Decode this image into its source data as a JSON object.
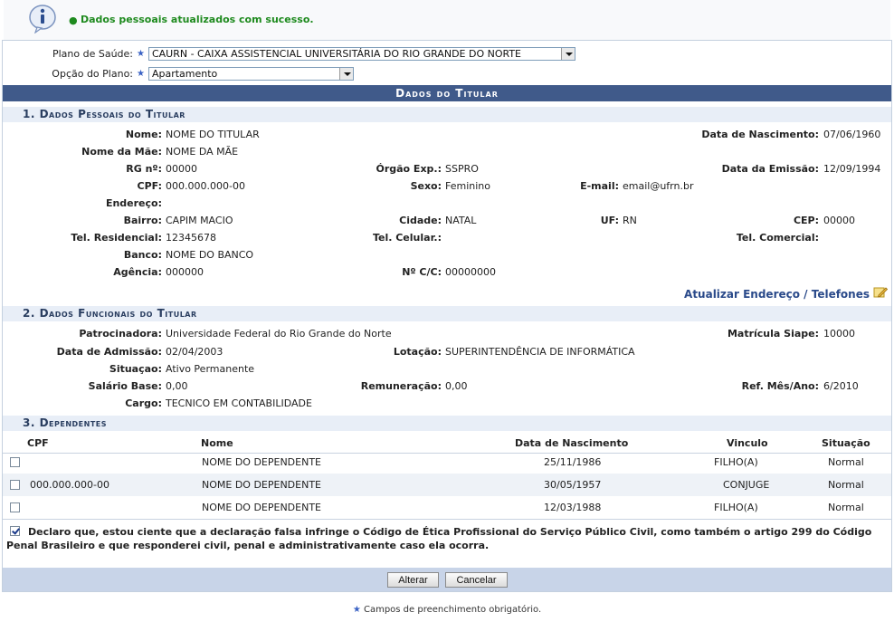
{
  "message": {
    "text": "Dados pessoais atualizados com sucesso."
  },
  "plan": {
    "health_label": "Plano de Saúde:",
    "health_value": "CAURN - CAIXA ASSISTENCIAL UNIVERSITÁRIA DO RIO GRANDE DO NORTE",
    "option_label": "Opção do Plano:",
    "option_value": "Apartamento"
  },
  "title": "Dados do Titular",
  "personal": {
    "heading": "1. Dados Pessoais do Titular",
    "nome_label": "Nome:",
    "nome": "NOME DO TITULAR",
    "nasc_label": "Data de Nascimento:",
    "nasc": "07/06/1960",
    "mae_label": "Nome da Mãe:",
    "mae": "NOME DA MÃE",
    "rg_label": "RG nº:",
    "rg": "00000",
    "orgao_label": "Órgão Exp.:",
    "orgao": "SSPRO",
    "emissao_label": "Data da Emissão:",
    "emissao": "12/09/1994",
    "cpf_label": "CPF:",
    "cpf": "000.000.000-00",
    "sexo_label": "Sexo:",
    "sexo": "Feminino",
    "email_label": "E-mail:",
    "email": "email@ufrn.br",
    "endereco_label": "Endereço:",
    "endereco": "",
    "bairro_label": "Bairro:",
    "bairro": "CAPIM MACIO",
    "cidade_label": "Cidade:",
    "cidade": "NATAL",
    "uf_label": "UF:",
    "uf": "RN",
    "cep_label": "CEP:",
    "cep": "00000",
    "telres_label": "Tel. Residencial:",
    "telres": "12345678",
    "telcel_label": "Tel. Celular.:",
    "telcel": "",
    "telcom_label": "Tel. Comercial:",
    "telcom": "",
    "banco_label": "Banco:",
    "banco": "NOME DO BANCO",
    "agencia_label": "Agência:",
    "agencia": "000000",
    "cc_label": "Nº C/C:",
    "cc": "00000000",
    "update_link": "Atualizar Endereço / Telefones"
  },
  "functional": {
    "heading": "2. Dados Funcionais do Titular",
    "patroc_label": "Patrocinadora:",
    "patroc": "Universidade Federal do Rio Grande do Norte",
    "siape_label": "Matrícula Siape:",
    "siape": "10000",
    "admissao_label": "Data de Admissão:",
    "admissao": "02/04/2003",
    "lotacao_label": "Lotação:",
    "lotacao": "SUPERINTENDÊNCIA DE INFORMÁTICA",
    "situacao_label": "Situaçao:",
    "situacao": "Ativo Permanente",
    "salario_label": "Salário Base:",
    "salario": "0,00",
    "remun_label": "Remuneração:",
    "remun": "0,00",
    "refmes_label": "Ref. Mês/Ano:",
    "refmes": "6/2010",
    "cargo_label": "Cargo:",
    "cargo": "TECNICO EM CONTABILIDADE"
  },
  "dependents": {
    "heading": "3. Dependentes",
    "columns": {
      "cpf": "CPF",
      "nome": "Nome",
      "nasc": "Data de Nascimento",
      "vinculo": "Vinculo",
      "situacao": "Situação"
    },
    "rows": [
      {
        "cpf": "",
        "nome": "NOME DO DEPENDENTE",
        "nasc": "25/11/1986",
        "vinculo": "FILHO(A)",
        "situacao": "Normal"
      },
      {
        "cpf": "000.000.000-00",
        "nome": "NOME DO DEPENDENTE",
        "nasc": "30/05/1957",
        "vinculo": "CONJUGE",
        "situacao": "Normal"
      },
      {
        "cpf": "",
        "nome": "NOME DO DEPENDENTE",
        "nasc": "12/03/1988",
        "vinculo": "FILHO(A)",
        "situacao": "Normal"
      }
    ]
  },
  "declaration": "Declaro que, estou ciente que a declaração falsa infringe o Código de Ética Profissional do Serviço Público Civil, como também o artigo 299 do Código Penal Brasileiro e que responderei civil, penal e administrativamente caso ela ocorra.",
  "buttons": {
    "alterar": "Alterar",
    "cancelar": "Cancelar"
  },
  "required_note": "Campos de preenchimento obrigatório."
}
